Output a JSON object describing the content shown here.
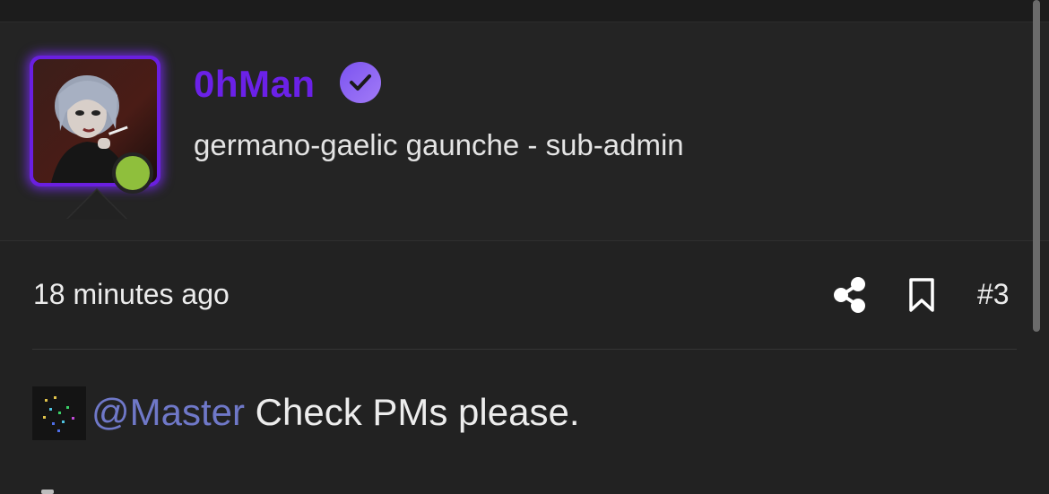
{
  "user": {
    "name": "0hMan",
    "title": "germano-gaelic gaunche - sub-admin",
    "verified": true,
    "online": true,
    "avatar_icon": "user-avatar",
    "verified_icon": "verified-check-icon"
  },
  "post": {
    "timestamp": "18 minutes ago",
    "number": "#3",
    "mention": "@Master",
    "text": " Check PMs please.",
    "actions": {
      "share_icon": "share-icon",
      "bookmark_icon": "bookmark-icon"
    }
  },
  "colors": {
    "username": "#6b21e8",
    "avatar_glow": "#7c2cff",
    "online": "#8fbf3c",
    "verified_badge": "#8b5cf6",
    "mention": "#6f78c8",
    "background": "#222222"
  }
}
